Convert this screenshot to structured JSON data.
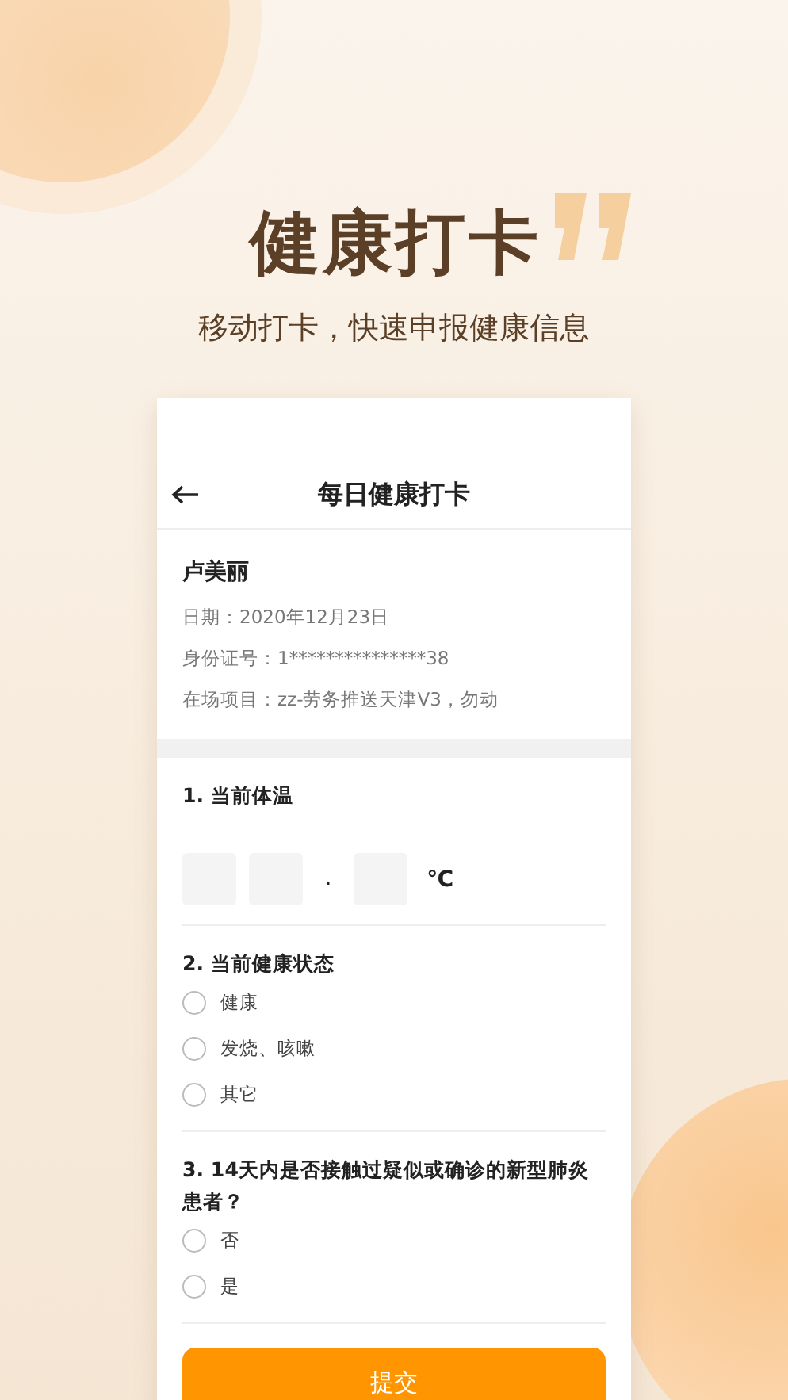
{
  "hero": {
    "title": "健康打卡",
    "subtitle": "移动打卡，快速申报健康信息"
  },
  "screen": {
    "nav": {
      "title": "每日健康打卡"
    },
    "profile": {
      "name": "卢美丽",
      "lines": [
        "日期：2020年12月23日",
        "身份证号：1***************38",
        "在场项目：zz-劳务推送天津V3，勿动"
      ]
    },
    "questions": [
      {
        "kind": "temperature",
        "title": "1. 当前体温",
        "separator": ".",
        "unit": "℃"
      },
      {
        "kind": "choice",
        "title": "2. 当前健康状态",
        "options": [
          {
            "label": "健康",
            "selected": false
          },
          {
            "label": "发烧、咳嗽",
            "selected": false
          },
          {
            "label": "其它",
            "selected": false
          }
        ]
      },
      {
        "kind": "choice",
        "title": "3. 14天内是否接触过疑似或确诊的新型肺炎患者？",
        "options": [
          {
            "label": "否",
            "selected": false
          },
          {
            "label": "是",
            "selected": false
          }
        ]
      }
    ],
    "submit": "提交"
  }
}
